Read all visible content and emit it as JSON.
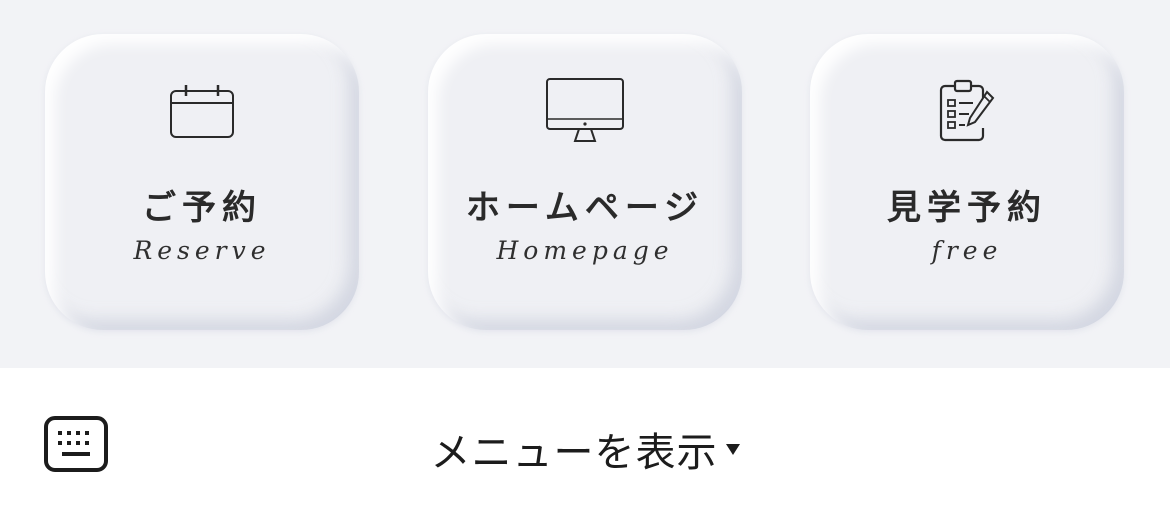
{
  "menu": {
    "background": "#f2f3f6",
    "card_color": "#eff0f4",
    "items": [
      {
        "title": "ご予約",
        "subtitle": "Reserve",
        "icon": "calendar-icon"
      },
      {
        "title": "ホームページ",
        "subtitle": "Homepage",
        "icon": "monitor-icon"
      },
      {
        "title": "見学予約",
        "subtitle": "free",
        "icon": "clipboard-edit-icon"
      }
    ]
  },
  "bottom_bar": {
    "toggle_label": "メニューを表示",
    "toggle_caret": "caret-down-icon",
    "keyboard_icon": "keyboard-icon"
  }
}
